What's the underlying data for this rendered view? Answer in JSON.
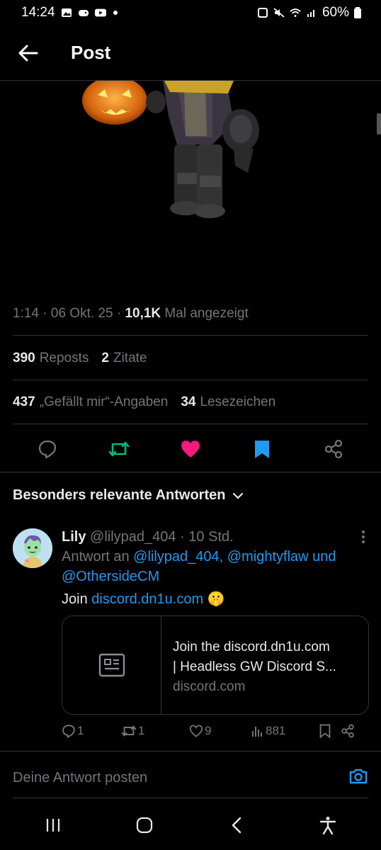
{
  "status_bar": {
    "time": "14:24",
    "battery": "60%"
  },
  "header": {
    "title": "Post"
  },
  "meta": {
    "time": "1:14",
    "date": "06 Okt. 25",
    "views_count": "10,1K",
    "views_label": "Mal angezeigt"
  },
  "stats": {
    "reposts_count": "390",
    "reposts_label": "Reposts",
    "quotes_count": "2",
    "quotes_label": "Zitate",
    "likes_count": "437",
    "likes_label": "„Gefällt mir“-Angaben",
    "bookmarks_count": "34",
    "bookmarks_label": "Lesezeichen"
  },
  "colors": {
    "repost": "#00ba7c",
    "like": "#f91880",
    "bookmark": "#1d9bf0"
  },
  "replies_sort": {
    "label": "Besonders relevante Antworten"
  },
  "reply": {
    "name": "Lily",
    "handle": "@lilypad_404",
    "time": "10 Std.",
    "reply_to_prefix": "Antwort an",
    "mention1": "@lilypad_404,",
    "mention2": "@mightyflaw",
    "and": "und",
    "mention3": "@OthersideCM",
    "text_prefix": "Join",
    "text_link": "discord.dn1u.com",
    "emoji": "🤫",
    "card": {
      "title_line1": "Join the discord.dn1u.com",
      "title_line2": "| Headless GW Discord S...",
      "domain": "discord.com"
    },
    "actions": {
      "replies": "1",
      "reposts": "1",
      "likes": "9",
      "views": "881"
    }
  },
  "compose": {
    "placeholder": "Deine Antwort posten"
  }
}
